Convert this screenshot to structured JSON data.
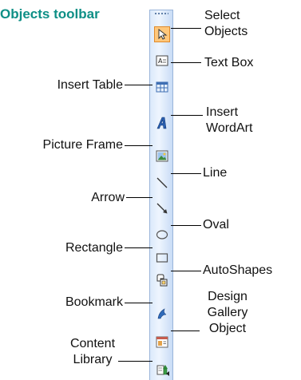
{
  "title": "Objects toolbar",
  "tools": [
    {
      "label": "Select Objects",
      "icon": "arrow-pointer-icon"
    },
    {
      "label": "Text Box",
      "icon": "text-box-icon"
    },
    {
      "label": "Insert Table",
      "icon": "table-icon"
    },
    {
      "label": "Insert WordArt",
      "icon": "wordart-icon"
    },
    {
      "label": "Picture Frame",
      "icon": "picture-icon"
    },
    {
      "label": "Line",
      "icon": "line-icon"
    },
    {
      "label": "Arrow",
      "icon": "arrow-icon"
    },
    {
      "label": "Oval",
      "icon": "oval-icon"
    },
    {
      "label": "Rectangle",
      "icon": "rectangle-icon"
    },
    {
      "label": "AutoShapes",
      "icon": "autoshapes-icon"
    },
    {
      "label": "Bookmark",
      "icon": "bookmark-icon"
    },
    {
      "label": "Design Gallery Object",
      "icon": "design-gallery-icon"
    },
    {
      "label": "Content Library",
      "icon": "content-library-icon"
    }
  ],
  "text": {
    "select_1": "Select",
    "select_2": "Objects",
    "text_box": "Text Box",
    "insert_table": "Insert Table",
    "wordart_1": "Insert",
    "wordart_2": "WordArt",
    "picture_frame": "Picture Frame",
    "line": "Line",
    "arrow": "Arrow",
    "oval": "Oval",
    "rectangle": "Rectangle",
    "autoshapes": "AutoShapes",
    "bookmark": "Bookmark",
    "design_1": "Design",
    "design_2": "Gallery",
    "design_3": "Object",
    "content_1": "Content",
    "content_2": "Library"
  },
  "colors": {
    "title": "#0e8f86",
    "toolbar_bg": "#dbe9fb",
    "selected_button": "#ffc77b"
  }
}
